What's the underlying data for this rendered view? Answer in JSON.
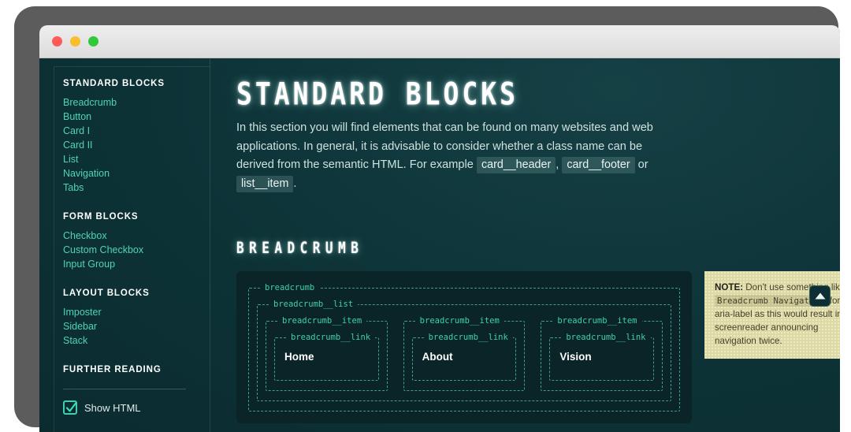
{
  "window": {
    "traffic_lights": [
      {
        "name": "close",
        "color": "#fc5b57"
      },
      {
        "name": "minimize",
        "color": "#fbbd2e"
      },
      {
        "name": "maximize",
        "color": "#2fc93a"
      }
    ]
  },
  "sidebar": {
    "groups": [
      {
        "heading": "STANDARD BLOCKS",
        "items": [
          "Breadcrumb",
          "Button",
          "Card I",
          "Card II",
          "List",
          "Navigation",
          "Tabs"
        ]
      },
      {
        "heading": "FORM BLOCKS",
        "items": [
          "Checkbox",
          "Custom Checkbox",
          "Input Group"
        ]
      },
      {
        "heading": "LAYOUT BLOCKS",
        "items": [
          "Imposter",
          "Sidebar",
          "Stack"
        ]
      },
      {
        "heading": "FURTHER READING",
        "items": []
      }
    ],
    "show_html": {
      "label": "Show HTML",
      "checked": true,
      "accent": "#3fcfae"
    }
  },
  "main": {
    "title": "STANDARD BLOCKS",
    "intro": {
      "part1": "In this section you will find elements that can be found on many websites and web applications. In general, it is advisable to consider whether a class name can be derived from the semantic HTML. For example",
      "code1": "card__header",
      "sep1": ",",
      "code2": "card__footer",
      "sep2": "or",
      "code3": "list__item",
      "sep3": "."
    },
    "section_title": "BREADCRUMB",
    "demo": {
      "outer_legend": "breadcrumb",
      "list_legend": "breadcrumb__list",
      "items": [
        {
          "item_legend": "breadcrumb__item",
          "link_legend": "breadcrumb__link",
          "label": "Home"
        },
        {
          "item_legend": "breadcrumb__item",
          "link_legend": "breadcrumb__link",
          "label": "About"
        },
        {
          "item_legend": "breadcrumb__item",
          "link_legend": "breadcrumb__link",
          "label": "Vision"
        }
      ]
    },
    "note": {
      "label": "NOTE:",
      "text_before": " Don't use something like ",
      "code": "Breadcrumb Navigation",
      "text_after": " for the aria-label as this would result in a screenreader announcing navigation twice."
    },
    "scroll_top": {
      "icon": "triangle-up-icon"
    }
  },
  "colors": {
    "page_bg": "#0d3337",
    "panel_bg": "#0a2427",
    "accent": "#3fd0ac",
    "link": "#4fd4b4",
    "note_bg": "#ddd9a3"
  }
}
